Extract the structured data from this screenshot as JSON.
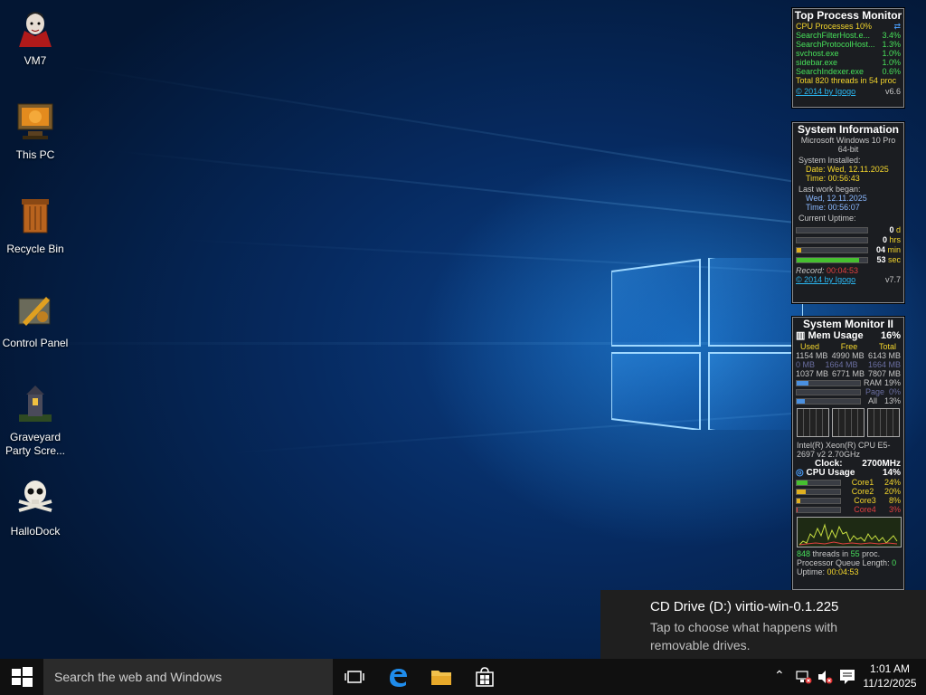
{
  "desktop_icons": [
    {
      "label": "VM7"
    },
    {
      "label": "This PC"
    },
    {
      "label": "Recycle Bin"
    },
    {
      "label": "Control Panel"
    },
    {
      "label": "Graveyard Party Scre..."
    },
    {
      "label": "HalloDock"
    }
  ],
  "top_process_monitor": {
    "title": "Top Process Monitor",
    "header_label": "CPU Processes 10%",
    "processes": [
      {
        "name": "SearchFilterHost.e...",
        "value": "3.4%"
      },
      {
        "name": "SearchProtocolHost...",
        "value": "1.3%"
      },
      {
        "name": "svchost.exe",
        "value": "1.0%"
      },
      {
        "name": "sidebar.exe",
        "value": "1.0%"
      },
      {
        "name": "SearchIndexer.exe",
        "value": "0.6%"
      }
    ],
    "total": "Total 820 threads in 54 proc",
    "copyright": "© 2014 by Igogo",
    "version": "v6.6"
  },
  "system_information": {
    "title": "System Information",
    "os": "Microsoft Windows 10 Pro 64-bit",
    "installed_label": "System Installed:",
    "installed_date": "Date: Wed, 12.11.2025",
    "installed_time": "Time: 00:56:43",
    "last_work_label": "Last work began:",
    "last_work_date": "Wed, 12.11.2025",
    "last_work_time": "Time: 00:56:07",
    "uptime_label": "Current Uptime:",
    "uptime": [
      {
        "value": "0",
        "unit": "d",
        "fraction": 0
      },
      {
        "value": "0",
        "unit": "hrs",
        "fraction": 0
      },
      {
        "value": "04",
        "unit": "min",
        "fraction": 0.07
      },
      {
        "value": "53",
        "unit": "sec",
        "fraction": 0.88
      }
    ],
    "record_label": "Record:",
    "record_value": "00:04:53",
    "copyright": "© 2014 by Igogo",
    "version": "v7.7"
  },
  "system_monitor": {
    "title": "System Monitor II",
    "mem_label": "Mem Usage",
    "mem_percent": "16%",
    "col_used": "Used",
    "col_free": "Free",
    "col_total": "Total",
    "mem_rows": [
      {
        "used": "1154 MB",
        "free": "4990 MB",
        "total": "6143 MB"
      },
      {
        "used": "0 MB",
        "free": "1664 MB",
        "total": "1664 MB"
      },
      {
        "used": "1037 MB",
        "free": "6771 MB",
        "total": "7807 MB"
      }
    ],
    "bars": [
      {
        "label": "RAM",
        "value": "19%",
        "fraction": 0.19
      },
      {
        "label": "Page",
        "value": "0%",
        "fraction": 0.0
      },
      {
        "label": "All",
        "value": "13%",
        "fraction": 0.13
      }
    ],
    "cpu_name": "Intel(R) Xeon(R) CPU E5-2697 v2 2.70GHz",
    "clock_label": "Clock:",
    "clock_value": "2700MHz",
    "cpu_label": "CPU Usage",
    "cpu_percent": "14%",
    "cores": [
      {
        "label": "Core1",
        "value": "24%",
        "fraction": 0.24
      },
      {
        "label": "Core2",
        "value": "20%",
        "fraction": 0.2
      },
      {
        "label": "Core3",
        "value": "8%",
        "fraction": 0.08
      },
      {
        "label": "Core4",
        "value": "3%",
        "fraction": 0.03
      }
    ],
    "threads": "848",
    "threads_mid": "threads in",
    "procs": "55",
    "procs_suffix": "proc.",
    "queue_label": "Processor Queue Length:",
    "queue_value": "0",
    "uptime_label": "Uptime:",
    "uptime_value": "00:04:53"
  },
  "toast": {
    "title": "CD Drive (D:) virtio-win-0.1.225",
    "body": "Tap to choose what happens with removable drives."
  },
  "taskbar": {
    "search_placeholder": "Search the web and Windows",
    "time": "1:01 AM",
    "date": "11/12/2025"
  }
}
